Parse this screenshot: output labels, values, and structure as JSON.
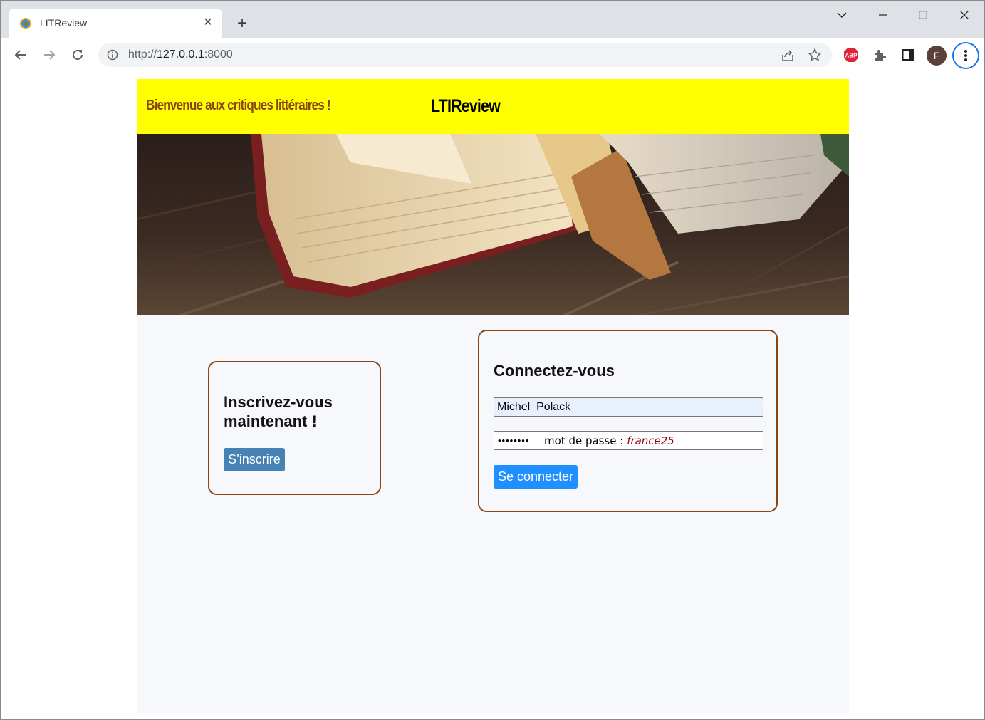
{
  "browser": {
    "tab": {
      "title": "LITReview"
    },
    "address_bar": {
      "scheme": "http://",
      "host": "127.0.0.1",
      "port": ":8000"
    },
    "extensions": {
      "abp_label": "ABP"
    },
    "profile": {
      "initial": "F"
    }
  },
  "page": {
    "header": {
      "welcome": "Bienvenue aux critiques littéraires !",
      "brand": "LTIReview"
    },
    "signup": {
      "title": "Inscrivez-vous maintenant !",
      "button": "S'inscrire"
    },
    "login": {
      "title": "Connectez-vous",
      "username_value": "Michel_Polack",
      "password_mask": "••••••••",
      "password_hint_label": "mot de passe : ",
      "password_hint_value": "france25",
      "button": "Se connecter"
    }
  },
  "colors": {
    "header_bg": "#ffff00",
    "welcome_text": "#8b4513",
    "card_border": "#8b4513",
    "signup_button": "#4682b4",
    "login_button": "#1e90ff",
    "autofill_bg": "#e8f0fe"
  },
  "icons": [
    "favicon-icon",
    "close-icon",
    "plus-icon",
    "chevron-down-icon",
    "minimize-icon",
    "maximize-icon",
    "close-window-icon",
    "back-icon",
    "forward-icon",
    "reload-icon",
    "info-icon",
    "share-icon",
    "star-icon",
    "adblock-icon",
    "extensions-icon",
    "side-panel-icon",
    "menu-icon"
  ]
}
